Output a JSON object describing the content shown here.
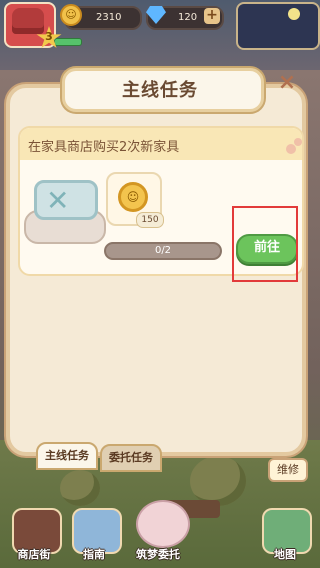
{
  "hud": {
    "level": "3",
    "coins": "2310",
    "gems": "120",
    "plus_label": "+"
  },
  "modal": {
    "title": "主线任务",
    "close_label": "×",
    "task_description": "在家具商店购买2次新家具",
    "reward_amount": "150",
    "progress_text": "0/2",
    "progress_fraction": 0,
    "go_button": "前往",
    "tabs": [
      {
        "label": "主线任务",
        "active": true
      },
      {
        "label": "委托任务",
        "active": false
      }
    ]
  },
  "scene": {
    "repair_label": "维修"
  },
  "bottom_nav": [
    {
      "label": "商店街",
      "icon": "shop-icon"
    },
    {
      "label": "指南",
      "icon": "guide-icon"
    },
    {
      "label": "筑梦委托",
      "icon": "commission-icon"
    },
    {
      "label": "地图",
      "icon": "map-icon"
    }
  ],
  "colors": {
    "accent_green": "#6cc45c",
    "highlight_red": "#e23a3a",
    "panel_cream": "#f5ead6"
  }
}
